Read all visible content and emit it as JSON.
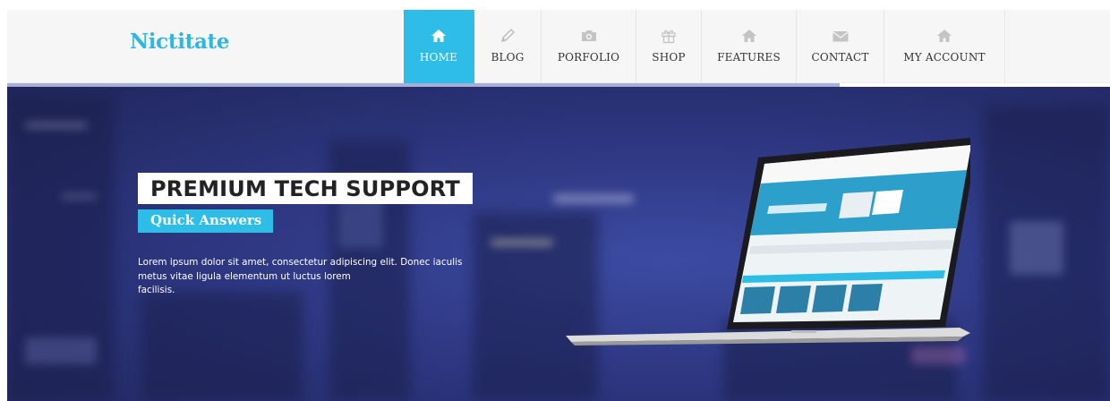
{
  "header": {
    "logo": "Nictitate",
    "nav": [
      {
        "label": "HOME",
        "icon": "home-icon",
        "active": true
      },
      {
        "label": "BLOG",
        "icon": "pencil-icon",
        "active": false
      },
      {
        "label": "PORFOLIO",
        "icon": "camera-icon",
        "active": false
      },
      {
        "label": "SHOP",
        "icon": "gift-icon",
        "active": false
      },
      {
        "label": "FEATURES",
        "icon": "home-icon",
        "active": false
      },
      {
        "label": "CONTACT",
        "icon": "envelope-icon",
        "active": false
      },
      {
        "label": "MY ACCOUNT",
        "icon": "home-icon",
        "active": false
      }
    ]
  },
  "hero": {
    "title": "PREMIUM TECH SUPPORT",
    "subtitle": "Quick Answers",
    "text_lines": [
      "Lorem ipsum dolor sit amet, consectetur adipiscing elit. Donec iaculis",
      "metus vitae ligula elementum ut luctus lorem",
      "facilisis."
    ],
    "image": "laptop-mockup"
  },
  "colors": {
    "accent": "#2ebde6",
    "accent_strip": "#a9aed8",
    "hero_background": "#2e3883",
    "header_background": "#f6f6f6"
  }
}
